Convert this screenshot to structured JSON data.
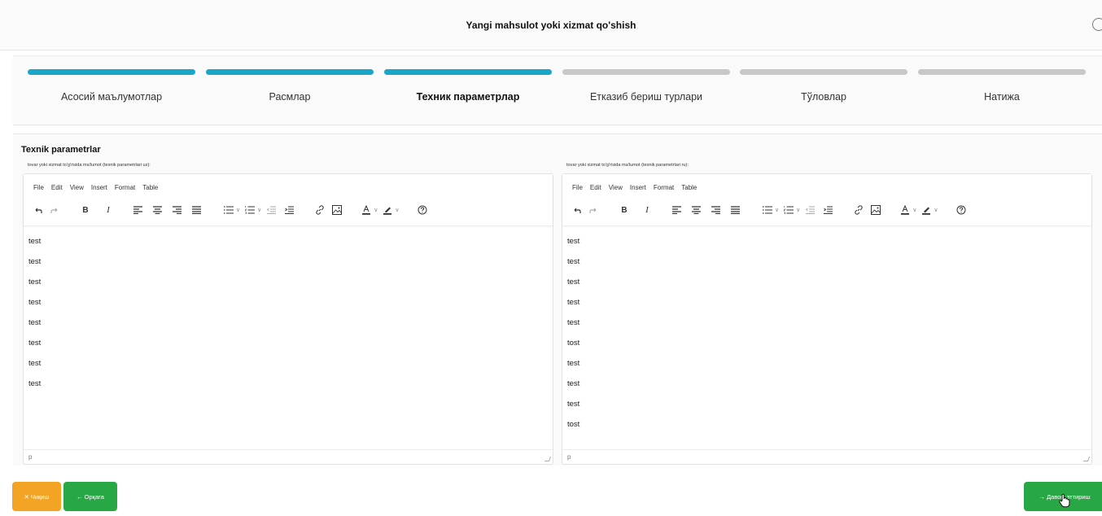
{
  "header": {
    "title": "Yangi mahsulot yoki xizmat qo'shish"
  },
  "steps": [
    {
      "label": "Асосий маълумотлар",
      "state": "done"
    },
    {
      "label": "Расмлар",
      "state": "done"
    },
    {
      "label": "Техник параметрлар",
      "state": "current"
    },
    {
      "label": "Етказиб бериш турлари",
      "state": "todo"
    },
    {
      "label": "Тўловлар",
      "state": "todo"
    },
    {
      "label": "Натижа",
      "state": "todo"
    }
  ],
  "section": {
    "title": "Texnik parametrlar"
  },
  "editors": [
    {
      "label": "tovar yoki xizmat to'g'risida ma'lumot (texnik parametrlari uz):",
      "menu": [
        "File",
        "Edit",
        "View",
        "Insert",
        "Format",
        "Table"
      ],
      "lines": [
        "test",
        "test",
        "test",
        "test",
        "test",
        "test",
        "test",
        "test"
      ],
      "status_path": "p"
    },
    {
      "label": "tovar yoki xizmat to'g'risida ma'lumot (texnik parametrlari ru):",
      "menu": [
        "File",
        "Edit",
        "View",
        "Insert",
        "Format",
        "Table"
      ],
      "lines": [
        "test",
        "test",
        "test",
        "test",
        "test",
        "tost",
        "test",
        "test",
        "test",
        "tost"
      ],
      "status_path": "p"
    }
  ],
  "buttons": {
    "exit": "✕ Чиқиш",
    "back": "← Орқага",
    "next": "→ Давом эттириш"
  },
  "colors": {
    "step_done": "#1aa6c9",
    "step_todo": "#c8c8c8",
    "exit_button": "#f4a425",
    "back_button": "#28a745",
    "next_button": "#28a745"
  }
}
